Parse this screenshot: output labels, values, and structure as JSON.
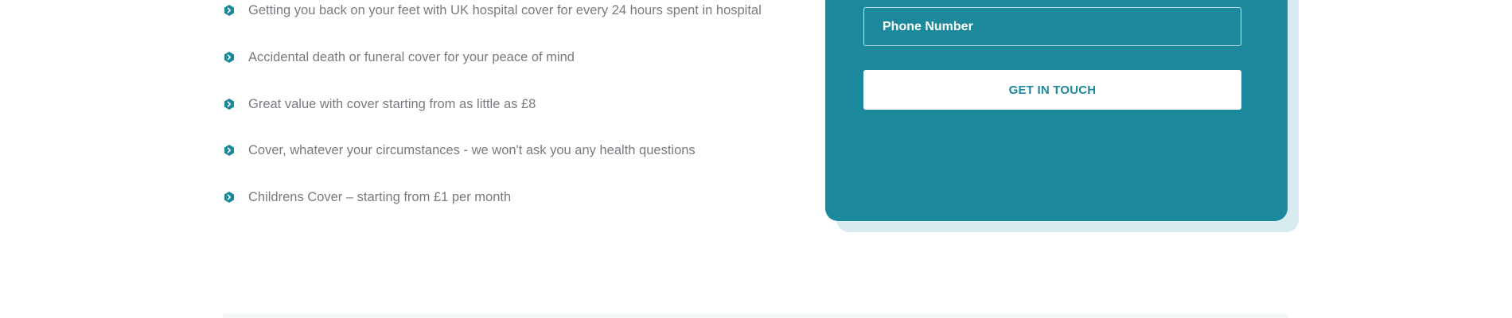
{
  "benefits": {
    "items": [
      {
        "icon": "chevron-right-bullet-icon",
        "text": "Getting you back on your feet with UK hospital cover for every 24 hours spent in hospital"
      },
      {
        "icon": "chevron-right-bullet-icon",
        "text": "Accidental death or funeral cover for your peace of mind"
      },
      {
        "icon": "chevron-right-bullet-icon",
        "text": "Great value with cover starting from as little as £8"
      },
      {
        "icon": "chevron-right-bullet-icon",
        "text": "Cover, whatever your circumstances - we won't ask you any health questions"
      },
      {
        "icon": "chevron-right-bullet-icon",
        "text": "Childrens Cover – starting from £1 per month"
      }
    ]
  },
  "contact_form": {
    "phone_placeholder": "Phone Number",
    "phone_value": "",
    "submit_label": "GET IN TOUCH"
  },
  "colors": {
    "accent": "#1c889b",
    "card_shadow": "#d8ebf1",
    "body_text": "#777b80",
    "background": "#ffffff"
  }
}
